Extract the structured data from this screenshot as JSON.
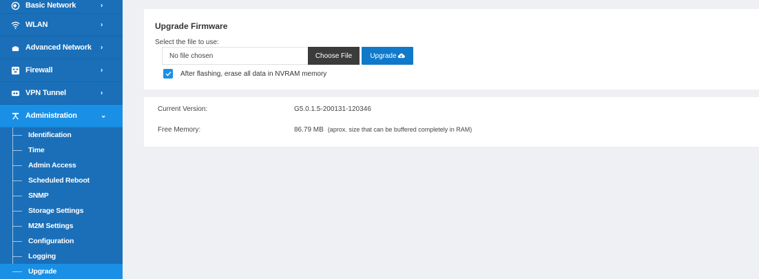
{
  "sidebar": {
    "items": [
      {
        "label": "Basic Network",
        "icon": "globe-icon"
      },
      {
        "label": "WLAN",
        "icon": "wifi-icon"
      },
      {
        "label": "Advanced Network",
        "icon": "network-icon"
      },
      {
        "label": "Firewall",
        "icon": "firewall-icon"
      },
      {
        "label": "VPN Tunnel",
        "icon": "vpn-icon"
      },
      {
        "label": "Administration",
        "icon": "admin-icon"
      }
    ],
    "subitems": [
      "Identification",
      "Time",
      "Admin Access",
      "Scheduled Reboot",
      "SNMP",
      "Storage Settings",
      "M2M Settings",
      "Configuration",
      "Logging",
      "Upgrade"
    ],
    "active_item": "Administration",
    "active_subitem": "Upgrade"
  },
  "upgrade": {
    "title": "Upgrade Firmware",
    "file_label": "Select the file to use:",
    "file_placeholder": "No file chosen",
    "choose_label": "Choose File",
    "upgrade_label": "Upgrade",
    "erase_label": "After flashing, erase all data in NVRAM memory",
    "erase_checked": true
  },
  "info": {
    "version_label": "Current Version:",
    "version_value": "G5.0.1.5-200131-120346",
    "memory_label": "Free Memory:",
    "memory_value": "86.79 MB",
    "memory_note": "(aprox. size that can be buffered completely in RAM)"
  },
  "colors": {
    "sidebar": "#1a6fb8",
    "active": "#1990e6",
    "upgrade_button": "#1179c9",
    "choose_button": "#3b3b3b"
  }
}
